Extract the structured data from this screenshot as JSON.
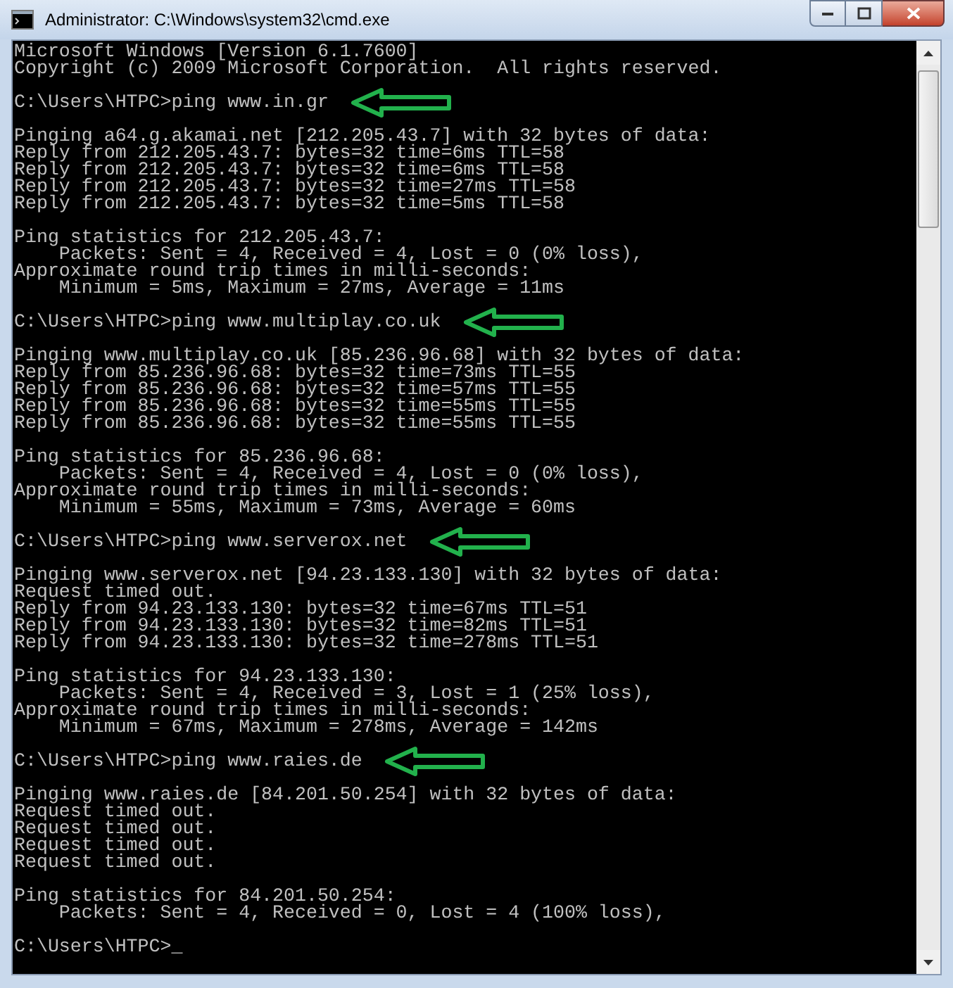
{
  "window": {
    "title": "Administrator: C:\\Windows\\system32\\cmd.exe"
  },
  "lines": [
    {
      "kind": "text",
      "text": "Microsoft Windows [Version 6.1.7600]"
    },
    {
      "kind": "text",
      "text": "Copyright (c) 2009 Microsoft Corporation.  All rights reserved."
    },
    {
      "kind": "blank"
    },
    {
      "kind": "prompt",
      "text": "C:\\Users\\HTPC>ping www.in.gr",
      "arrow": true
    },
    {
      "kind": "blank"
    },
    {
      "kind": "text",
      "text": "Pinging a64.g.akamai.net [212.205.43.7] with 32 bytes of data:"
    },
    {
      "kind": "text",
      "text": "Reply from 212.205.43.7: bytes=32 time=6ms TTL=58"
    },
    {
      "kind": "text",
      "text": "Reply from 212.205.43.7: bytes=32 time=6ms TTL=58"
    },
    {
      "kind": "text",
      "text": "Reply from 212.205.43.7: bytes=32 time=27ms TTL=58"
    },
    {
      "kind": "text",
      "text": "Reply from 212.205.43.7: bytes=32 time=5ms TTL=58"
    },
    {
      "kind": "blank"
    },
    {
      "kind": "text",
      "text": "Ping statistics for 212.205.43.7:"
    },
    {
      "kind": "text",
      "text": "    Packets: Sent = 4, Received = 4, Lost = 0 (0% loss),"
    },
    {
      "kind": "text",
      "text": "Approximate round trip times in milli-seconds:"
    },
    {
      "kind": "text",
      "text": "    Minimum = 5ms, Maximum = 27ms, Average = 11ms"
    },
    {
      "kind": "blank"
    },
    {
      "kind": "prompt",
      "text": "C:\\Users\\HTPC>ping www.multiplay.co.uk",
      "arrow": true
    },
    {
      "kind": "blank"
    },
    {
      "kind": "text",
      "text": "Pinging www.multiplay.co.uk [85.236.96.68] with 32 bytes of data:"
    },
    {
      "kind": "text",
      "text": "Reply from 85.236.96.68: bytes=32 time=73ms TTL=55"
    },
    {
      "kind": "text",
      "text": "Reply from 85.236.96.68: bytes=32 time=57ms TTL=55"
    },
    {
      "kind": "text",
      "text": "Reply from 85.236.96.68: bytes=32 time=55ms TTL=55"
    },
    {
      "kind": "text",
      "text": "Reply from 85.236.96.68: bytes=32 time=55ms TTL=55"
    },
    {
      "kind": "blank"
    },
    {
      "kind": "text",
      "text": "Ping statistics for 85.236.96.68:"
    },
    {
      "kind": "text",
      "text": "    Packets: Sent = 4, Received = 4, Lost = 0 (0% loss),"
    },
    {
      "kind": "text",
      "text": "Approximate round trip times in milli-seconds:"
    },
    {
      "kind": "text",
      "text": "    Minimum = 55ms, Maximum = 73ms, Average = 60ms"
    },
    {
      "kind": "blank"
    },
    {
      "kind": "prompt",
      "text": "C:\\Users\\HTPC>ping www.serverox.net",
      "arrow": true
    },
    {
      "kind": "blank"
    },
    {
      "kind": "text",
      "text": "Pinging www.serverox.net [94.23.133.130] with 32 bytes of data:"
    },
    {
      "kind": "text",
      "text": "Request timed out."
    },
    {
      "kind": "text",
      "text": "Reply from 94.23.133.130: bytes=32 time=67ms TTL=51"
    },
    {
      "kind": "text",
      "text": "Reply from 94.23.133.130: bytes=32 time=82ms TTL=51"
    },
    {
      "kind": "text",
      "text": "Reply from 94.23.133.130: bytes=32 time=278ms TTL=51"
    },
    {
      "kind": "blank"
    },
    {
      "kind": "text",
      "text": "Ping statistics for 94.23.133.130:"
    },
    {
      "kind": "text",
      "text": "    Packets: Sent = 4, Received = 3, Lost = 1 (25% loss),"
    },
    {
      "kind": "text",
      "text": "Approximate round trip times in milli-seconds:"
    },
    {
      "kind": "text",
      "text": "    Minimum = 67ms, Maximum = 278ms, Average = 142ms"
    },
    {
      "kind": "blank"
    },
    {
      "kind": "prompt",
      "text": "C:\\Users\\HTPC>ping www.raies.de",
      "arrow": true
    },
    {
      "kind": "blank"
    },
    {
      "kind": "text",
      "text": "Pinging www.raies.de [84.201.50.254] with 32 bytes of data:"
    },
    {
      "kind": "text",
      "text": "Request timed out."
    },
    {
      "kind": "text",
      "text": "Request timed out."
    },
    {
      "kind": "text",
      "text": "Request timed out."
    },
    {
      "kind": "text",
      "text": "Request timed out."
    },
    {
      "kind": "blank"
    },
    {
      "kind": "text",
      "text": "Ping statistics for 84.201.50.254:"
    },
    {
      "kind": "text",
      "text": "    Packets: Sent = 4, Received = 0, Lost = 4 (100% loss),"
    },
    {
      "kind": "blank"
    },
    {
      "kind": "prompt",
      "text": "C:\\Users\\HTPC>_",
      "arrow": false
    }
  ]
}
